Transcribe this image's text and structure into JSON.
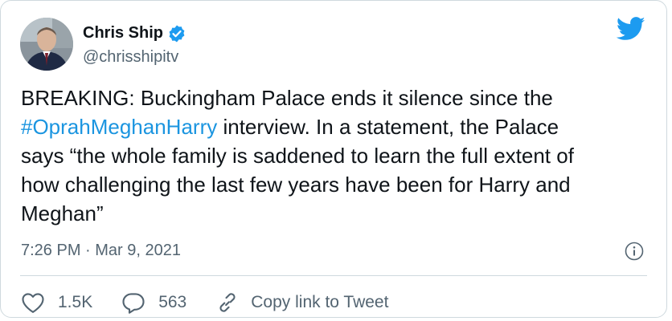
{
  "author": {
    "display_name": "Chris Ship",
    "handle": "@chrisshipitv",
    "verified_icon": "verified-badge-icon",
    "avatar_icon": "profile-photo"
  },
  "tweet": {
    "text_before": "BREAKING: Buckingham Palace ends it silence since the\n",
    "hashtag": "#OprahMeghanHarry",
    "text_after": " interview. In a statement, the Palace\nsays “the whole family is saddened to learn the full extent of\nhow challenging the last few years have been for Harry and\nMeghan”",
    "timestamp": "7:26 PM · Mar 9, 2021"
  },
  "actions": {
    "likes": "1.5K",
    "replies": "563",
    "copy_link_label": "Copy link to Tweet"
  },
  "colors": {
    "accent": "#1d9bf0",
    "hashtag": "#1b95e0",
    "text": "#0f1419",
    "muted": "#536471",
    "border": "#cfd9de"
  },
  "icons": {
    "brand": "twitter-bird-icon",
    "info": "info-icon",
    "like": "heart-icon",
    "reply": "reply-bubble-icon",
    "link": "link-icon"
  }
}
